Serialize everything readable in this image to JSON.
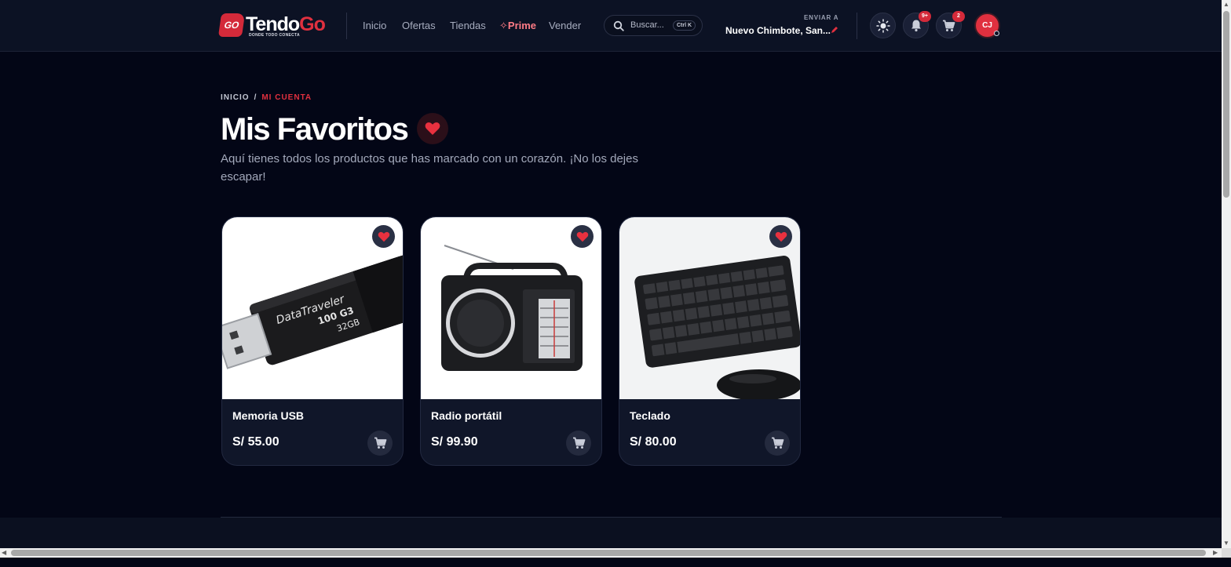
{
  "header": {
    "logo_badge": "GO",
    "logo_main": "Tendo",
    "logo_accent": "Go",
    "logo_tagline": "DONDE TODO CONECTA",
    "nav": [
      {
        "label": "Inicio"
      },
      {
        "label": "Ofertas"
      },
      {
        "label": "Tiendas"
      },
      {
        "label": "✧Prime"
      },
      {
        "label": "Vender"
      }
    ],
    "search": {
      "placeholder": "Buscar...",
      "shortcut": "Ctrl K"
    },
    "shipping": {
      "label": "ENVIAR A",
      "city": "Nuevo Chimbote, San..."
    },
    "notifications_badge": "9+",
    "cart_badge": "2",
    "avatar_initials": "CJ"
  },
  "breadcrumb": {
    "home": "INICIO",
    "separator": "/",
    "current": "MI CUENTA"
  },
  "page": {
    "title": "Mis Favoritos",
    "subtitle": "Aquí tienes todos los productos que has marcado con un corazón. ¡No los dejes escapar!"
  },
  "products": [
    {
      "name": "Memoria USB",
      "price": "S/ 55.00",
      "image": "usb-flash-drive-image"
    },
    {
      "name": "Radio portátil",
      "price": "S/ 99.90",
      "image": "portable-radio-image"
    },
    {
      "name": "Teclado",
      "price": "S/ 80.00",
      "image": "keyboard-and-mouse-image"
    }
  ],
  "colors": {
    "background": "#030616",
    "header": "#0c1224",
    "accent": "#e0303f",
    "card": "#101629"
  }
}
